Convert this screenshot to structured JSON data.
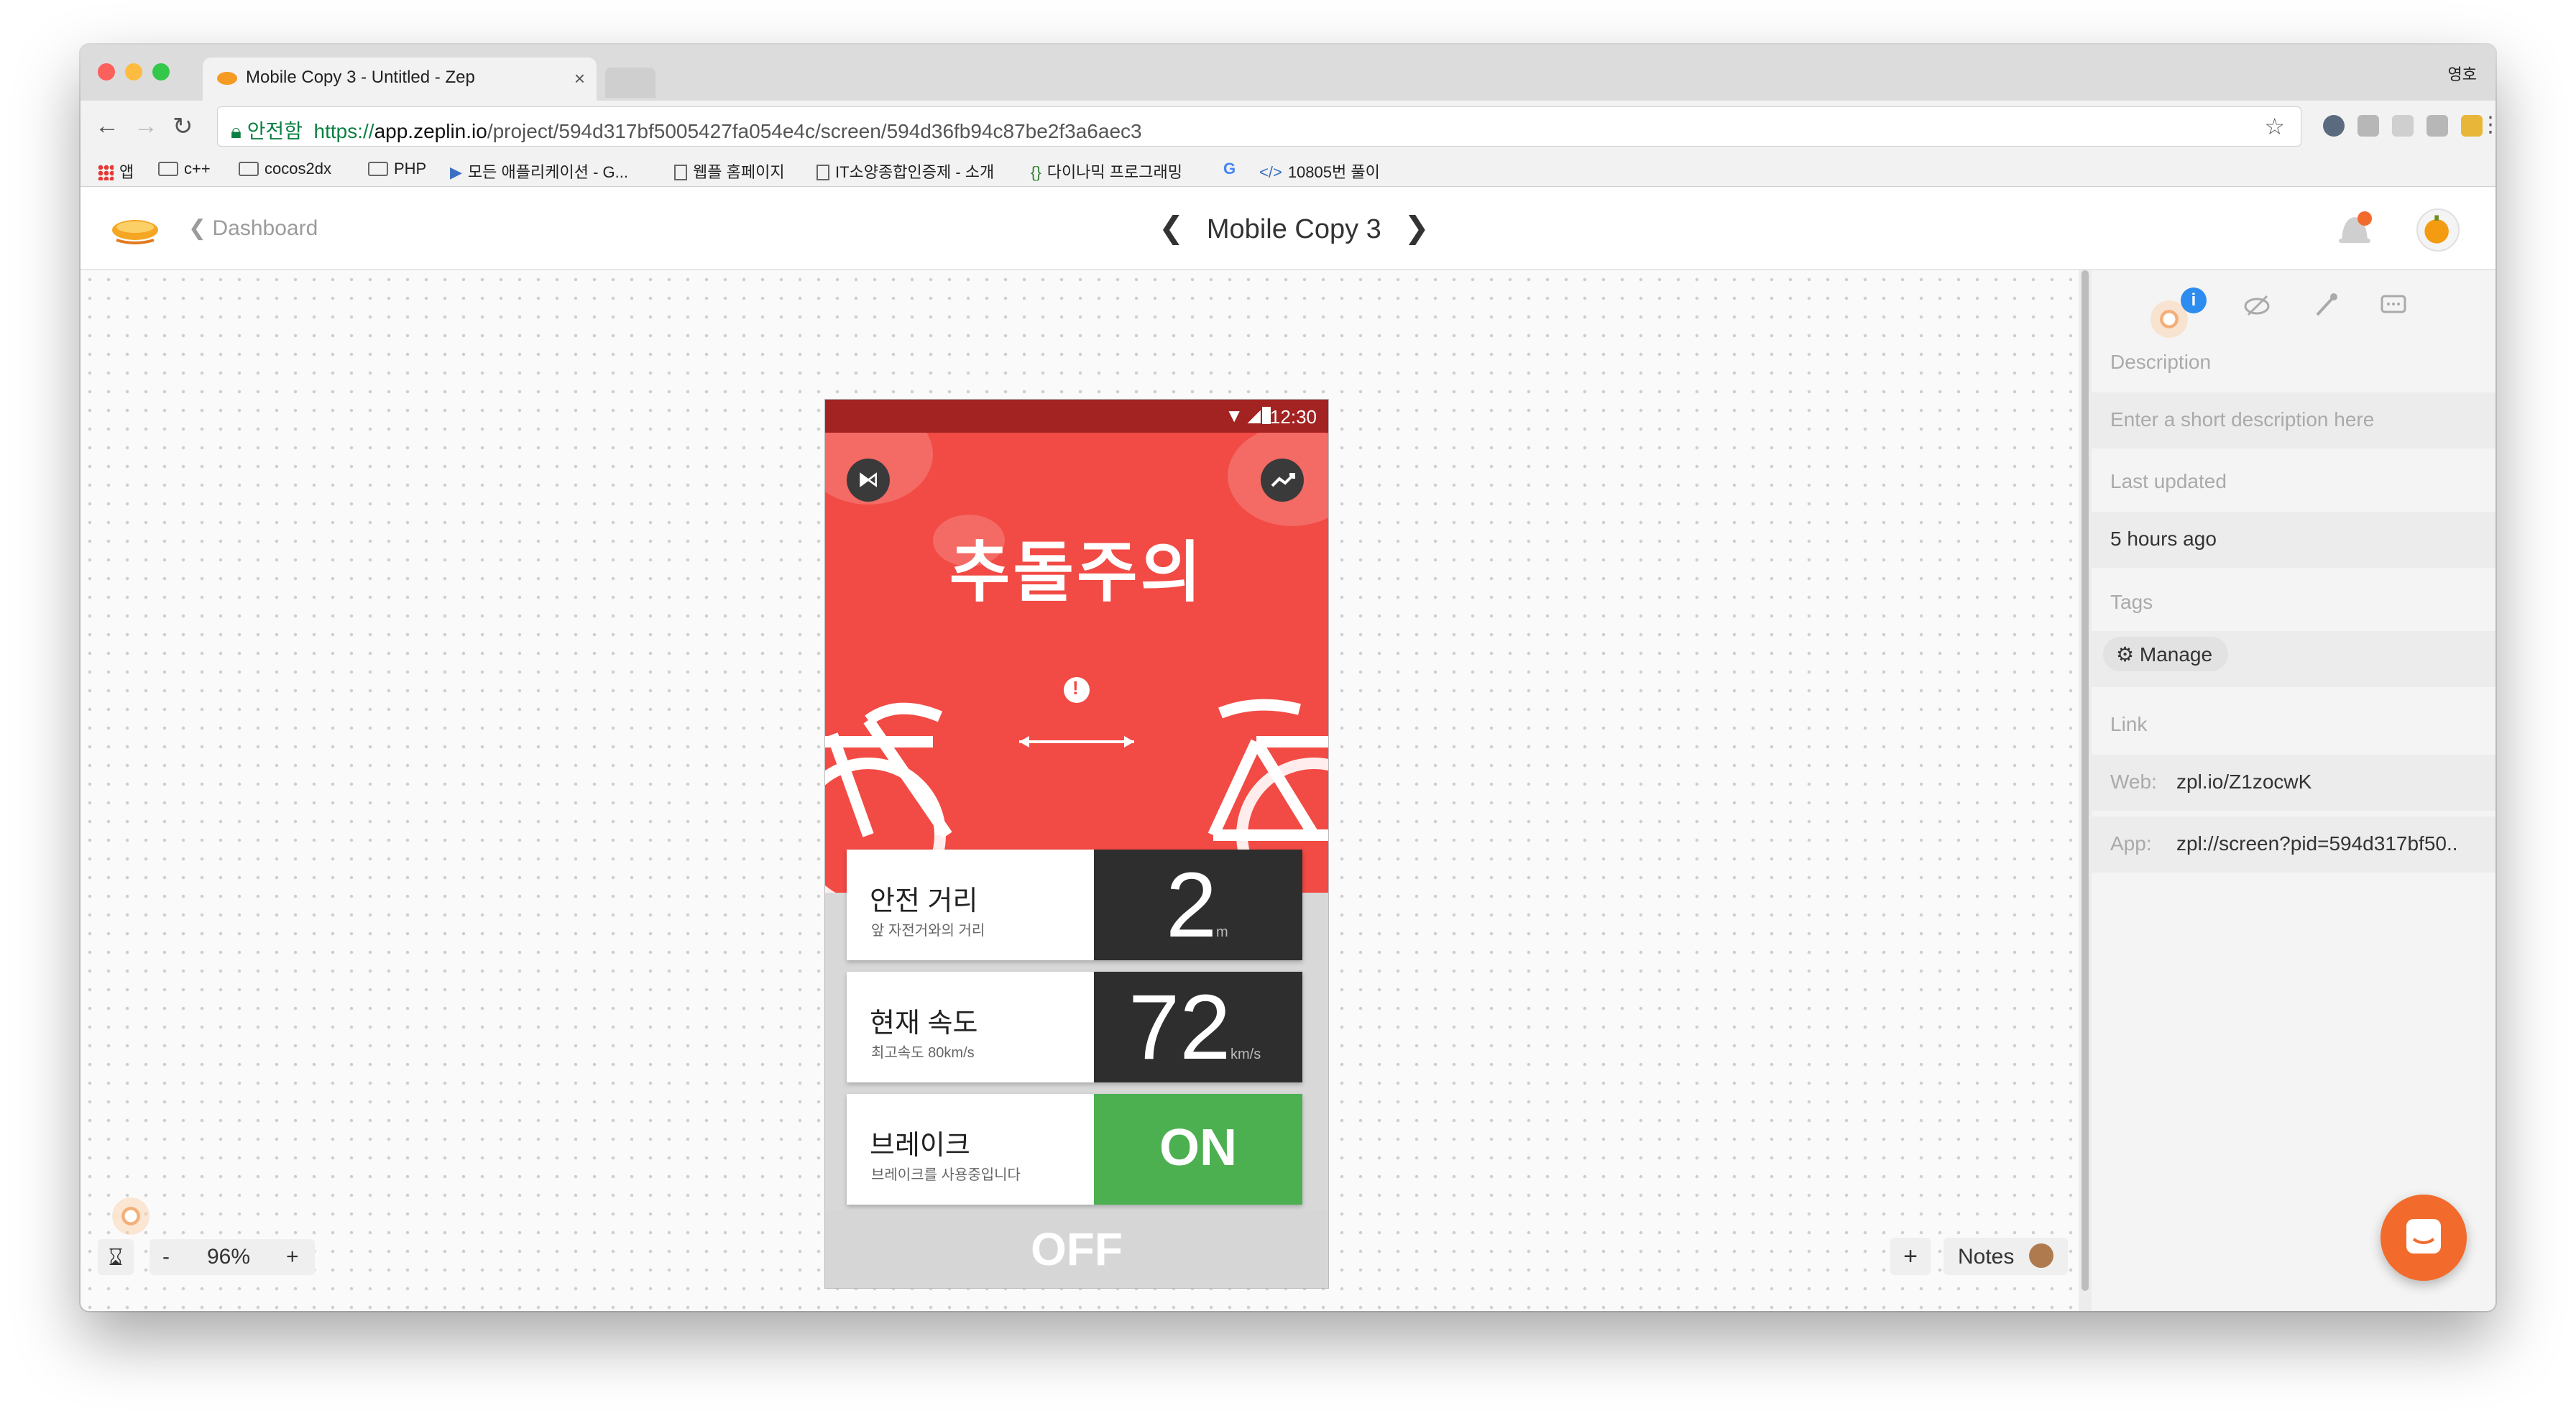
{
  "browser": {
    "tab_title": "Mobile Copy 3 - Untitled - Zep",
    "tab_close": "×",
    "profile_name": "영호",
    "url_secure_label": "안전함",
    "url_scheme": "https://",
    "url_host": "app.zeplin.io",
    "url_path": "/project/594d317bf5005427fa054e4c/screen/594d36fb94c87be2f3a6aec3",
    "nav_back": "←",
    "nav_forward": "→",
    "nav_reload": "↻",
    "star": "☆",
    "menu": "⋮",
    "bookmarks": [
      {
        "label": "앱",
        "kind": "apps"
      },
      {
        "label": "c++",
        "kind": "folder"
      },
      {
        "label": "cocos2dx",
        "kind": "folder"
      },
      {
        "label": "PHP",
        "kind": "folder"
      },
      {
        "label": "모든 애플리케이션 - G...",
        "kind": "flag"
      },
      {
        "label": "웹플 홈페이지",
        "kind": "doc"
      },
      {
        "label": "IT소양종합인증제 - 소개",
        "kind": "doc"
      },
      {
        "label": "다이나믹 프로그래밍",
        "kind": "code"
      },
      {
        "label": "",
        "kind": "google"
      },
      {
        "label": "10805번 풀이",
        "kind": "code"
      }
    ]
  },
  "header": {
    "back_label": "Dashboard",
    "screen_title": "Mobile Copy 3",
    "prev": "❮",
    "next": "❯"
  },
  "artboard": {
    "status_time": "12:30",
    "bluetooth_icon": "bluetooth-icon",
    "trend_icon": "trending-icon",
    "warning_glyph": "!",
    "title": "추돌주의",
    "cards": [
      {
        "label": "안전 거리",
        "sub": "앞 자전거와의 거리",
        "value": "2",
        "unit": "m"
      },
      {
        "label": "현재 속도",
        "sub": "최고속도 80km/s",
        "value": "72",
        "unit": "km/s"
      },
      {
        "label": "브레이크",
        "sub": "브레이크를 사용중입니다",
        "value": "ON",
        "unit": ""
      }
    ],
    "off_label": "OFF",
    "colors": {
      "hero": "#f24a44",
      "status": "#a32222",
      "value_bg": "#2e2e2e",
      "on_bg": "#4caf50"
    }
  },
  "canvas_controls": {
    "zoom_out": "-",
    "zoom_level": "96%",
    "zoom_in": "+",
    "add": "+",
    "notes_label": "Notes"
  },
  "panel": {
    "info_badge": "i",
    "description_heading": "Description",
    "description_placeholder": "Enter a short description here",
    "last_updated_heading": "Last updated",
    "last_updated_value": "5 hours ago",
    "tags_heading": "Tags",
    "manage_label": "Manage",
    "link_heading": "Link",
    "web_label": "Web:",
    "web_value": "zpl.io/Z1zocwK",
    "app_label": "App:",
    "app_value": "zpl://screen?pid=594d317bf50.."
  }
}
